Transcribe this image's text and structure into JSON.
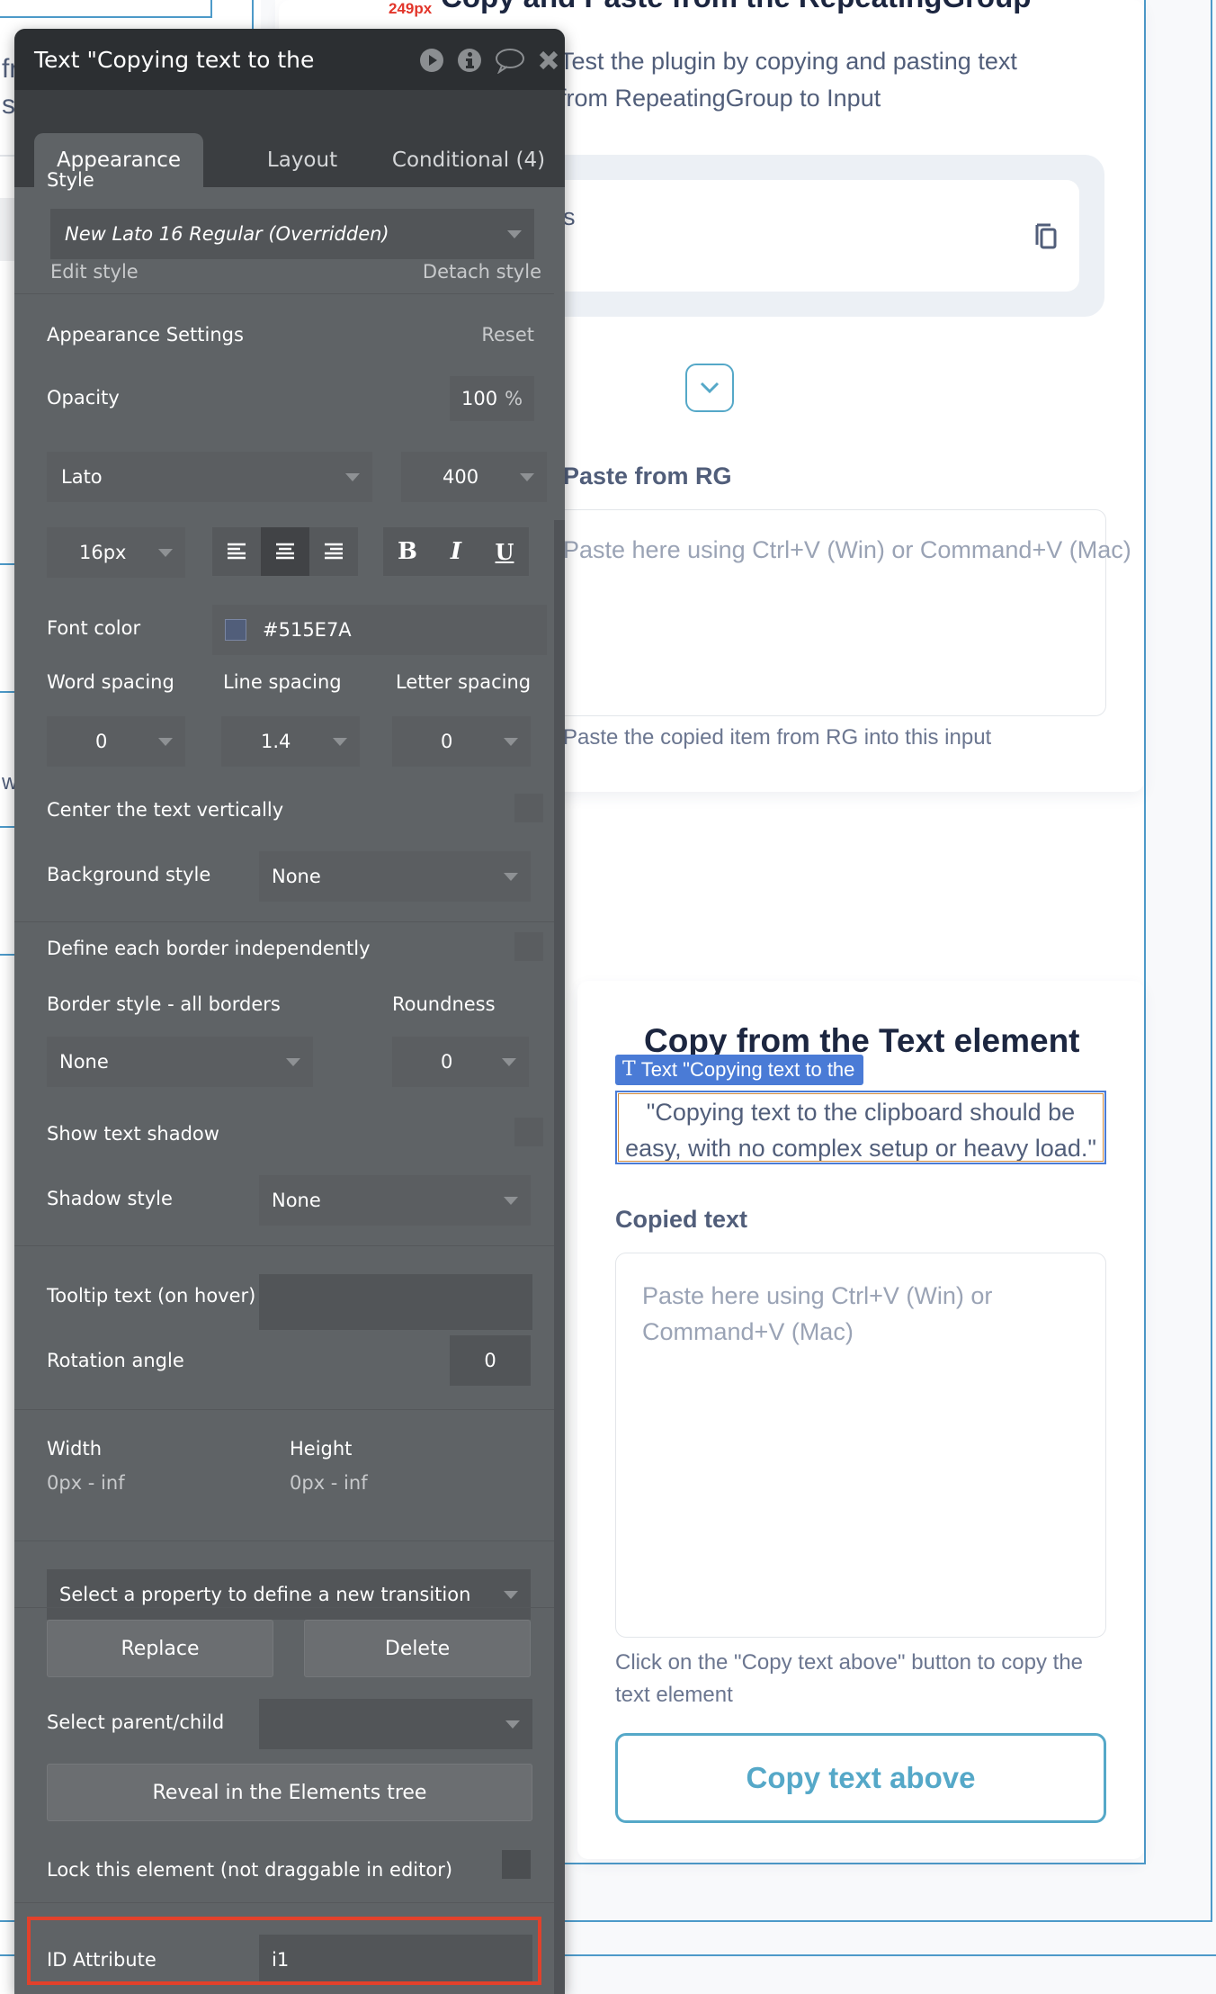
{
  "canvas": {
    "page_title": "Copy and Paste from the RepeatingGroup",
    "size_indicator": "249px",
    "subtitle_line1": "Test the plugin by copying and pasting text",
    "subtitle_line2": "from RepeatingGroup to Input",
    "left_fragments": [
      "fr",
      "se",
      "w"
    ],
    "rg_item_fragment": "s",
    "rg_section_label": "Paste from RG",
    "rg_input_placeholder": "Paste here using Ctrl+V (Win) or Command+V (Mac)",
    "rg_help_text": "Paste the copied item from RG into this input",
    "text_card": {
      "title": "Copy from the Text element",
      "selection_tag": "Text \"Copying text to the",
      "quote_text": "\"Copying text to the clipboard should be easy, with no complex setup or heavy load.\"",
      "copied_label": "Copied text",
      "copied_placeholder": "Paste here using Ctrl+V (Win) or Command+V (Mac)",
      "help_text": "Click on the \"Copy text above\" button to copy the text element",
      "copy_button": "Copy text above"
    },
    "colors": {
      "accent": "#55a8c8",
      "selection": "#4a7bd6",
      "text": "#515e7a"
    }
  },
  "panel": {
    "title": "Text \"Copying text to the",
    "icons": [
      "play-icon",
      "info-icon",
      "comment-icon",
      "close-icon"
    ],
    "tabs": [
      {
        "label": "Appearance",
        "active": true
      },
      {
        "label": "Layout",
        "active": false
      },
      {
        "label": "Conditional (4)",
        "active": false
      }
    ],
    "style_label": "Style",
    "style_value": "New Lato 16 Regular (Overridden)",
    "edit_style": "Edit style",
    "detach_style": "Detach style",
    "appearance_settings": "Appearance Settings",
    "reset": "Reset",
    "opacity_label": "Opacity",
    "opacity_value": "100",
    "opacity_unit": "%",
    "font_family": "Lato",
    "font_weight": "400",
    "font_size": "16px",
    "alignment": {
      "options": [
        "left",
        "center",
        "right"
      ],
      "selected": "center"
    },
    "format_buttons": [
      "B",
      "I",
      "U"
    ],
    "font_color_label": "Font color",
    "font_color_value": "#515E7A",
    "word_spacing_label": "Word spacing",
    "word_spacing_value": "0",
    "line_spacing_label": "Line spacing",
    "line_spacing_value": "1.4",
    "letter_spacing_label": "Letter spacing",
    "letter_spacing_value": "0",
    "center_vertically_label": "Center the text vertically",
    "background_style_label": "Background style",
    "background_style_value": "None",
    "define_border_label": "Define each border independently",
    "border_style_label": "Border style - all borders",
    "border_style_value": "None",
    "roundness_label": "Roundness",
    "roundness_value": "0",
    "show_shadow_label": "Show text shadow",
    "shadow_style_label": "Shadow style",
    "shadow_style_value": "None",
    "tooltip_label": "Tooltip text (on hover)",
    "tooltip_value": "",
    "rotation_label": "Rotation angle",
    "rotation_value": "0",
    "width_label": "Width",
    "width_value": "0px - inf",
    "height_label": "Height",
    "height_value": "0px - inf",
    "transition_placeholder": "Select a property to define a new transition",
    "replace_button": "Replace",
    "delete_button": "Delete",
    "parent_child_label": "Select parent/child",
    "reveal_button": "Reveal in the Elements tree",
    "lock_label": "Lock this element (not draggable in editor)",
    "id_attribute_label": "ID Attribute",
    "id_attribute_value": "i1"
  }
}
